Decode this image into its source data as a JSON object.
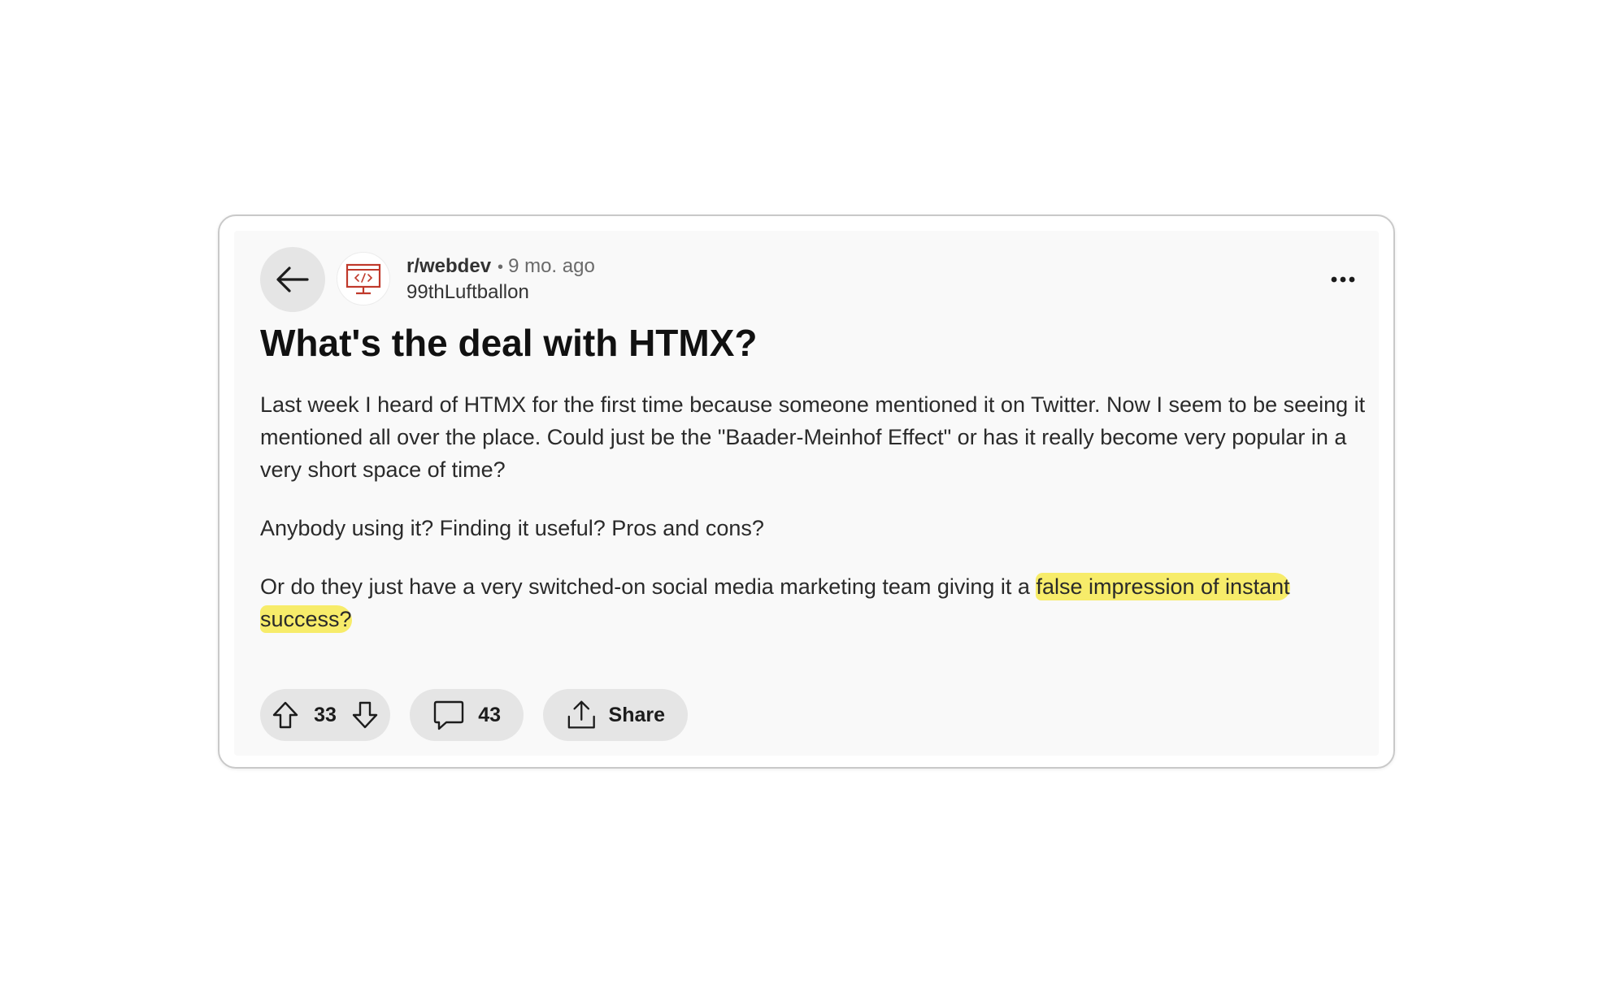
{
  "post": {
    "subreddit": "r/webdev",
    "separator": "•",
    "age": "9 mo. ago",
    "author": "99thLuftballon",
    "title": "What's the deal with HTMX?",
    "body": {
      "p1": "Last week I heard of HTMX for the first time because someone mentioned it on Twitter. Now I seem to be seeing it mentioned all over the place. Could just be the \"Baader-Meinhof Effect\" or has it really become very popular in a very short space of time?",
      "p2": "Anybody using it? Finding it useful? Pros and cons?",
      "p3_plain": "Or do they just have a very switched-on social media marketing team giving it a ",
      "p3_highlight": "false impression of instant success?"
    },
    "highlight_color": "#f7ec6a"
  },
  "actions": {
    "upvote_icon": "arrow-up-outline-icon",
    "score": "33",
    "downvote_icon": "arrow-down-outline-icon",
    "comment_icon": "speech-bubble-icon",
    "comments": "43",
    "share_icon": "share-upload-icon",
    "share_label": "Share"
  },
  "icons": {
    "back": "arrow-left-icon",
    "subreddit_avatar": "monitor-code-icon",
    "more": "ellipsis-horizontal-icon"
  },
  "colors": {
    "avatar_accent": "#c0392b",
    "pill_background": "#e5e5e5"
  }
}
